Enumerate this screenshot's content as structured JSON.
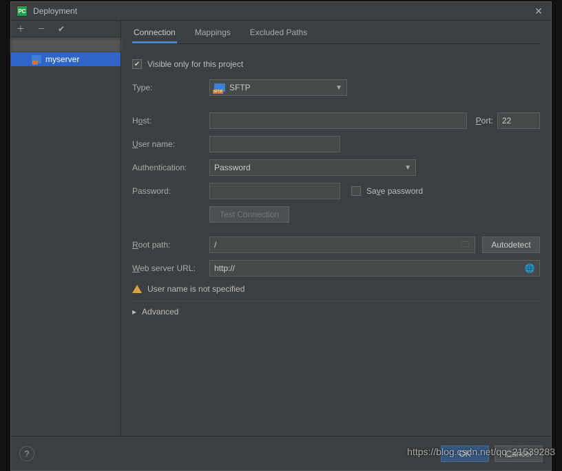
{
  "window": {
    "title": "Deployment"
  },
  "sidebar": {
    "items": [
      {
        "label": ""
      },
      {
        "label": "myserver"
      }
    ]
  },
  "tabs": {
    "connection": "Connection",
    "mappings": "Mappings",
    "excluded": "Excluded Paths"
  },
  "form": {
    "visible_only_label": "Visible only for this project",
    "type_label": "Type:",
    "type_value": "SFTP",
    "host_label_pre": "H",
    "host_label_u": "o",
    "host_label_post": "st:",
    "host_value": "",
    "port_label_u": "P",
    "port_label_post": "ort:",
    "port_value": "22",
    "user_label_u": "U",
    "user_label_post": "ser name:",
    "user_value": "",
    "auth_label": "Authentication:",
    "auth_value": "Password",
    "password_label": "Password:",
    "password_value": "",
    "save_password_pre": "Sa",
    "save_password_u": "v",
    "save_password_post": "e password",
    "test_connection": "Test Connection",
    "root_label_u": "R",
    "root_label_post": "oot path:",
    "root_value": "/",
    "autodetect": "Autodetect",
    "web_label_u": "W",
    "web_label_post": "eb server URL:",
    "web_value": "http://",
    "warning": "User name is not specified",
    "advanced": "Advanced"
  },
  "footer": {
    "ok": "OK",
    "cancel": "Cancel"
  },
  "watermark": "https://blog.csdn.net/qq_21539283"
}
